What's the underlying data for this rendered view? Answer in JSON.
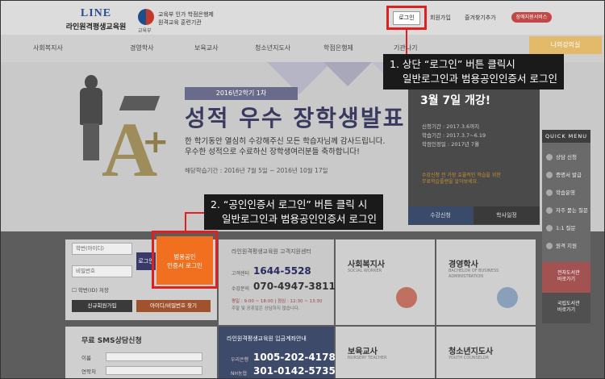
{
  "header": {
    "logo_mark": "LINE",
    "logo_name": "라인원격평생교육원",
    "ministry_label": "교육부",
    "ministry_text_1": "교육부 인가 학점은행제",
    "ministry_text_2": "원격교육 훈련기관",
    "login_label": "로그인",
    "util_links": [
      "회원가입",
      "즐겨찾기추가"
    ],
    "pill_label": "장애지원서비스"
  },
  "nav": {
    "items": [
      "사회복지사",
      "경영학사",
      "보육교사",
      "청소년지도사",
      "학점은행제",
      "기관나기"
    ],
    "end_label": "나의강의실"
  },
  "hero": {
    "badge": "2016년2학기 1차",
    "title": "성적 우수 장학생발표",
    "desc_1": "한 학기동안 열심히 수강해주신 모든 학습자님께 감사드립니다.",
    "desc_2": "우수한 성적으로 수료하신 장학생여러분들 축하합니다!",
    "period": "해당학습기간 : 2016년 7월 5일 ~ 2016년 10월 17일"
  },
  "promo": {
    "title": "3월 7일 개강!",
    "lines": [
      "신청기간 : 2017.3.6까지",
      "학습기간 : 2017.3.7~6.19",
      "학점인정일 : 2017년 7월"
    ],
    "note_1": "수강신청 전 가장 효율적인 학습을 위한",
    "note_2": "무료학습플랜을 알아보세요.",
    "btn_apply": "수강신청",
    "btn_schedule": "학사일정"
  },
  "quick_menu": {
    "title": "QUICK MENU",
    "items": [
      "상담 신청",
      "증명서 발급",
      "학습운영",
      "자주 묻는 질문",
      "1:1 질문",
      "원격 지원"
    ],
    "red_1": "전자도서관",
    "red_2": "바로가기",
    "dark_1": "국립도서관",
    "dark_2": "바로가기"
  },
  "login_form": {
    "id_placeholder": "학번(아이디)",
    "pw_placeholder": "비밀번호",
    "login_label": "로그인",
    "cert_line_1": "범용공인",
    "cert_line_2": "인증서 로그인",
    "save_id": "학번(ID) 저장",
    "signup": "신규회원가입",
    "find": "아이디/비밀번호 찾기"
  },
  "sms": {
    "title": "무료 SMS상담신청",
    "name_label": "이름",
    "phone_label": "연락처"
  },
  "support": {
    "title": "라인원격평생교육원 고객지원센터",
    "label_1": "고객센터",
    "phone_1": "1644-5528",
    "label_2": "수강문의",
    "phone_2": "070-4947-3811",
    "hours_1": "평일 : 9:00 ~ 18:00 | 점심 : 12:30 ~ 13:30",
    "hours_2": "주말 및 공휴일은 상담하지 않습니다."
  },
  "account": {
    "title": "라인원격평생교육원 입금계좌안내",
    "bank_1": "우리은행",
    "acct_1": "1005-202-417818",
    "bank_2": "NH농협",
    "acct_2": "301-0142-5735-01"
  },
  "tiles": [
    {
      "title": "사회복지사",
      "sub": "SOCIAL WORKER"
    },
    {
      "title": "경영학사",
      "sub_1": "BACHELOR OF BUSINESS",
      "sub_2": "ADMINISTRATION"
    },
    {
      "title": "보육교사",
      "sub": "NURSERY TEACHER"
    },
    {
      "title": "청소년지도사",
      "sub": "YOUTH COUNSELOR"
    }
  ],
  "callouts": {
    "one_1": "1. 상단 “로그인” 버튼 클릭시",
    "one_2": "일반로그인과 범용공인인증서 로그인",
    "two_1": "2. “공인인증서 로그인” 버튼 클릭 시",
    "two_2": "일반로그인과 범용공인인증서 로그인"
  },
  "colors": {
    "highlight": "#e02020",
    "cert_button": "#f07020",
    "callout_bg": "#1a1a1a"
  }
}
